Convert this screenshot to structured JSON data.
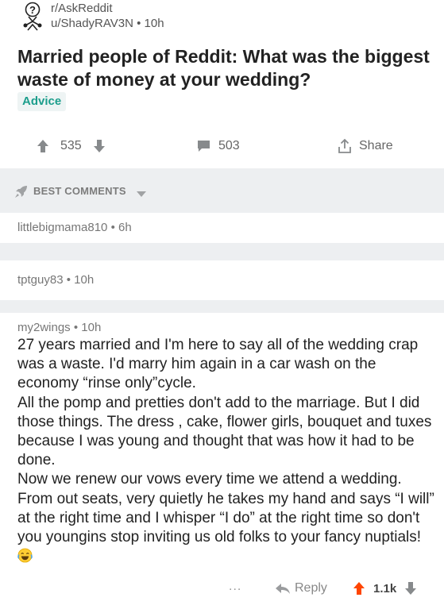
{
  "post": {
    "subreddit": "r/AskReddit",
    "author": "u/ShadyRAV3N",
    "age": "10h",
    "title": "Married people of Reddit: What was the biggest waste of money at your wedding?",
    "flair": "Advice",
    "upvotes": "535",
    "comment_count": "503",
    "share_label": "Share"
  },
  "sort": {
    "label": "BEST COMMENTS"
  },
  "collapsed_comments": [
    {
      "user": "littlebigmama810",
      "age": "6h"
    },
    {
      "user": "tptguy83",
      "age": "10h"
    }
  ],
  "comment": {
    "user": "my2wings",
    "age": "10h",
    "paragraphs": [
      "27 years married and I'm here to say all of the wedding crap was a waste.  I'd marry him again in a car wash on the economy “rinse only”cycle.",
      "All the pomp and pretties don't add to the marriage. But I did those things.  The dress , cake, flower girls, bouquet and tuxes because I was young and thought that was how it had to be done.",
      "Now we renew our vows every time we attend a wedding.  From out seats, very quietly he takes my hand and says “I will” at the right time and I whisper “I do” at the right time so don't you youngins stop inviting us old folks to your fancy nuptials!"
    ],
    "more_label": "...",
    "reply_label": "Reply",
    "score": "1.1k"
  },
  "colors": {
    "upvote": "#ff4500",
    "flair": "#1c9e8c",
    "band": "#edeff1"
  },
  "icons": [
    "askreddit-icon",
    "upvote-icon",
    "downvote-icon",
    "comment-icon",
    "share-icon",
    "rocket-icon",
    "caret-down-icon",
    "reply-icon",
    "laughing-emoji-icon"
  ]
}
